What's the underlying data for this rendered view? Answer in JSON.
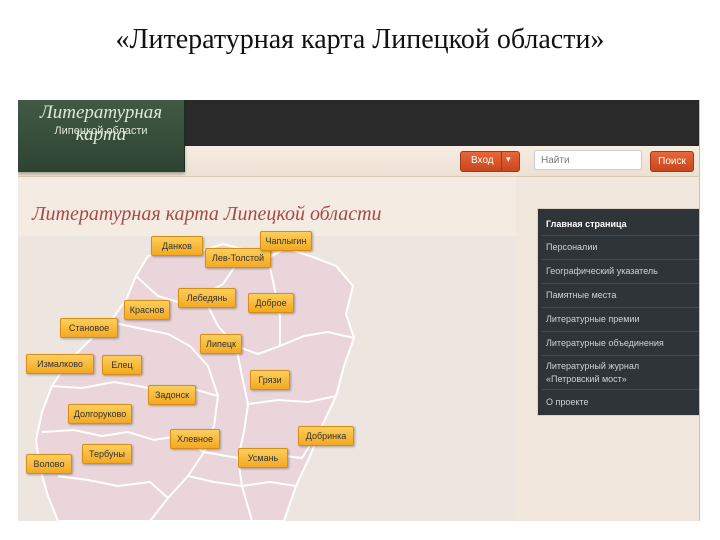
{
  "slide": {
    "title": "«Литературная карта Липецкой области»"
  },
  "logo": {
    "title": "Литературная карта",
    "subtitle": "Липецкой области"
  },
  "header": {
    "login_label": "Вход",
    "login_caret": "▾",
    "search_placeholder": "Найти",
    "search_button": "Поиск"
  },
  "page": {
    "title": "Литературная карта Липецкой области"
  },
  "map": {
    "fill_color": "#ead5da",
    "border_color": "#ffffff",
    "tag_color": "#f7b733",
    "towns": [
      "Данков",
      "Лев-Толстой",
      "Чаплыгин",
      "Лебедянь",
      "Доброе",
      "Краснов",
      "Становое",
      "Липецк",
      "Измалково",
      "Елец",
      "Грязи",
      "Задонск",
      "Долгоруково",
      "Хлевное",
      "Добринка",
      "Тербуны",
      "Усмань",
      "Воловo"
    ]
  },
  "sidebar": {
    "items": [
      {
        "label": "Главная страница"
      },
      {
        "label": "Персоналии"
      },
      {
        "label": "Географический указатель"
      },
      {
        "label": "Памятные места"
      },
      {
        "label": "Литературные премии"
      },
      {
        "label": "Литературные объединения"
      },
      {
        "label": "Литературный журнал"
      },
      {
        "label": "О проекте"
      }
    ],
    "journal_second_line": "«Петровский мост»"
  }
}
